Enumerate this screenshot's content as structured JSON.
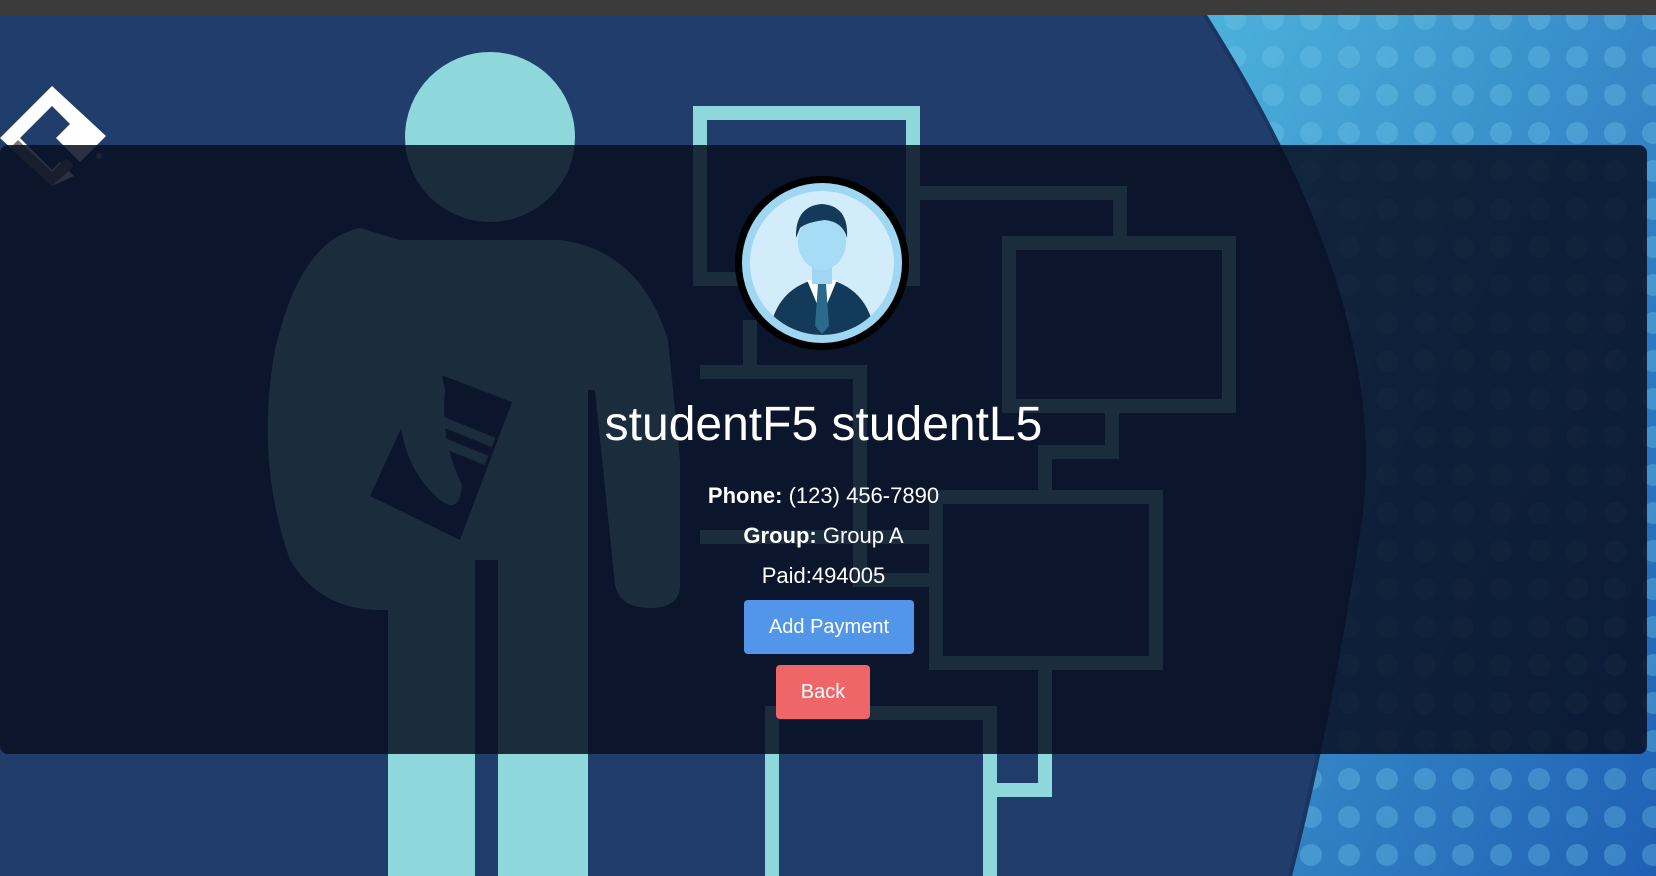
{
  "student": {
    "name": "studentF5 studentL5",
    "phone_label": "Phone:",
    "phone_value": "(123) 456-7890",
    "group_label": "Group:",
    "group_value": "Group A",
    "paid_text": "Paid:494005"
  },
  "actions": {
    "add_payment_label": "Add Payment",
    "back_label": "Back"
  },
  "colors": {
    "background": "#213d6b",
    "panel": "#080f22",
    "figure": "#8ed8dc",
    "add_payment_button": "#5196e8",
    "back_button": "#ef6669"
  },
  "icons": {
    "logo": "brand-logo",
    "avatar": "businessman-avatar"
  }
}
